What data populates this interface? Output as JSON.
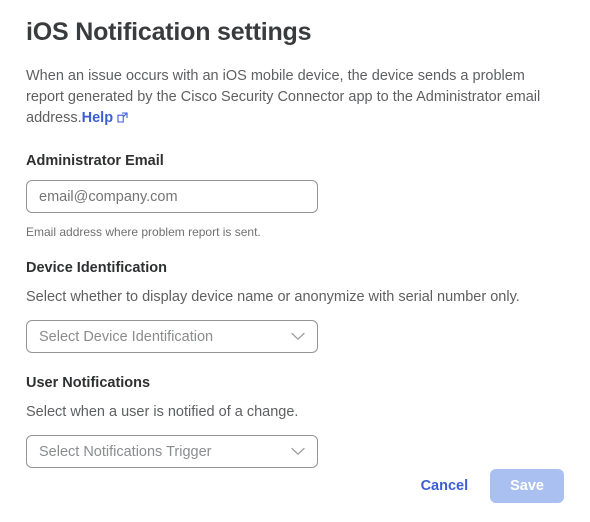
{
  "page": {
    "title": "iOS Notification settings",
    "intro_text": "When an issue occurs with an iOS mobile device, the device sends a problem report generated by the Cisco Security Connector app to the Administrator email address.",
    "help_link_label": "Help",
    "help_link_icon": "external-link-icon"
  },
  "administrator_email": {
    "label": "Administrator Email",
    "placeholder": "email@company.com",
    "value": "",
    "helper_text": "Email address where problem report is sent."
  },
  "device_identification": {
    "label": "Device Identification",
    "description": "Select whether to display device name or anonymize with serial number only.",
    "placeholder": "Select Device Identification",
    "selected": "",
    "chevron_icon": "chevron-down-icon"
  },
  "user_notifications": {
    "label": "User Notifications",
    "description": "Select when a user is notified of a change.",
    "placeholder": "Select Notifications Trigger",
    "selected": "",
    "chevron_icon": "chevron-down-icon"
  },
  "actions": {
    "cancel_label": "Cancel",
    "save_label": "Save"
  },
  "colors": {
    "link_blue": "#3b5fd4",
    "save_disabled_blue": "#a9c0f0",
    "title_gray": "#3a3b3d",
    "body_gray": "#5e5f61",
    "border_gray": "#929496",
    "placeholder_gray": "#8a8c8e",
    "background": "#ffffff"
  }
}
